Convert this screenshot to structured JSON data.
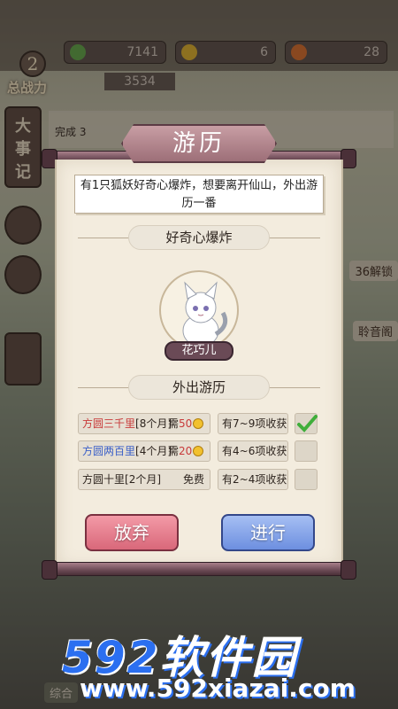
{
  "hud": {
    "level": "2",
    "power_label": "总战力",
    "power_value": "3534",
    "resources": [
      "7141",
      "6",
      "28"
    ]
  },
  "background": {
    "side_menu_main": "大事记",
    "mission_text": "完成 3",
    "right_tag_unlock": "36",
    "right_tag_unlock_text": "解锁",
    "right_tag_hall": "聆音阁",
    "bottom_tag": "综合"
  },
  "dialog": {
    "title": "游历",
    "story": "有1只狐妖好奇心爆炸，想要离开仙山，外出游历一番",
    "event_title": "好奇心爆炸",
    "character_name": "花巧儿",
    "section_title": "外出游历",
    "options": [
      {
        "label": "方圆三千里",
        "duration": "[8个月]",
        "cost_prefix": "需",
        "cost": "50",
        "result": "有7~9项收获",
        "selected": true
      },
      {
        "label": "方圆两百里",
        "duration": "[4个月]",
        "cost_prefix": "需",
        "cost": "20",
        "result": "有4~6项收获",
        "selected": false
      },
      {
        "label": "方圆十里",
        "duration": "[2个月]",
        "cost_prefix": "",
        "cost": "免费",
        "result": "有2~4项收获",
        "selected": false
      }
    ],
    "cancel_label": "放弃",
    "confirm_label": "进行"
  },
  "watermark": {
    "brand_num": "592",
    "brand_cn": "软件园",
    "url": "www.592xiazai.com"
  },
  "colors": {
    "option_red": "#c83a3a",
    "option_blue": "#3a5fc8",
    "check_green": "#3fae3a",
    "brand_blue": "#2b6ff0"
  }
}
